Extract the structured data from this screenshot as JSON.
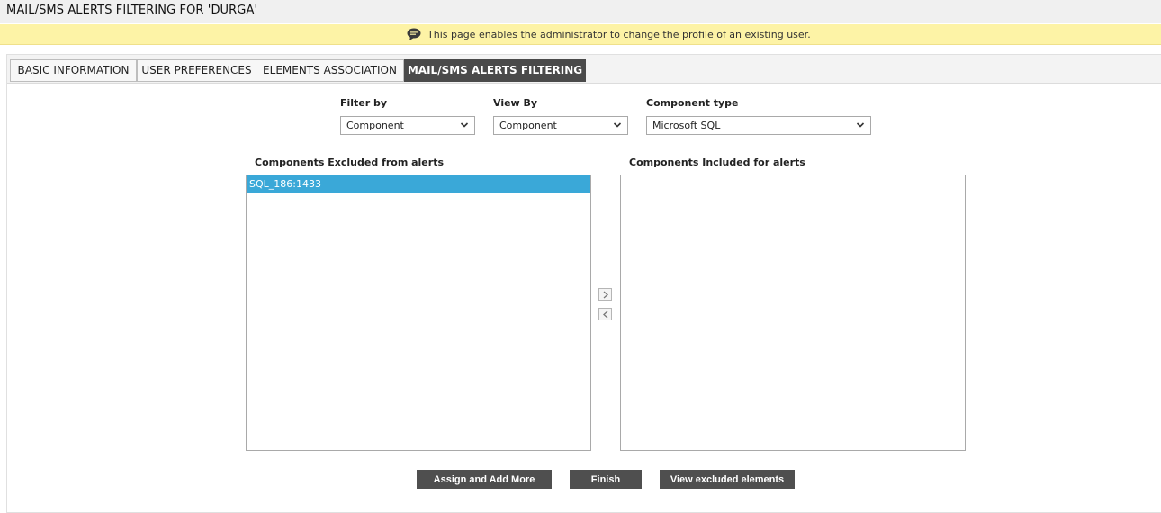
{
  "page": {
    "title": "MAIL/SMS ALERTS FILTERING FOR 'DURGA'"
  },
  "banner": {
    "icon": "speech-bubble-icon",
    "text": "This page enables the administrator to change the profile of an existing user."
  },
  "tabs": [
    {
      "label": "BASIC INFORMATION",
      "active": false
    },
    {
      "label": "USER PREFERENCES",
      "active": false
    },
    {
      "label": "ELEMENTS ASSOCIATION",
      "active": false
    },
    {
      "label": "MAIL/SMS ALERTS FILTERING",
      "active": true
    }
  ],
  "filters": {
    "filter_by": {
      "label": "Filter by",
      "value": "Component"
    },
    "view_by": {
      "label": "View By",
      "value": "Component"
    },
    "component_type": {
      "label": "Component type",
      "value": "Microsoft SQL"
    }
  },
  "excluded": {
    "label": "Components Excluded from alerts",
    "items": [
      {
        "text": "SQL_186:1433",
        "selected": true
      }
    ]
  },
  "included": {
    "label": "Components Included for alerts",
    "items": []
  },
  "move_buttons": {
    "include_icon": "chevron-right-icon",
    "exclude_icon": "chevron-left-icon"
  },
  "actions": {
    "assign_label": "Assign and Add More",
    "finish_label": "Finish",
    "view_excluded_label": "View excluded elements"
  },
  "colors": {
    "banner_bg": "#fdf3a6",
    "active_tab_bg": "#4a4a4a",
    "selected_item_bg": "#3aa8d8",
    "button_bg": "#4f4f4f"
  }
}
